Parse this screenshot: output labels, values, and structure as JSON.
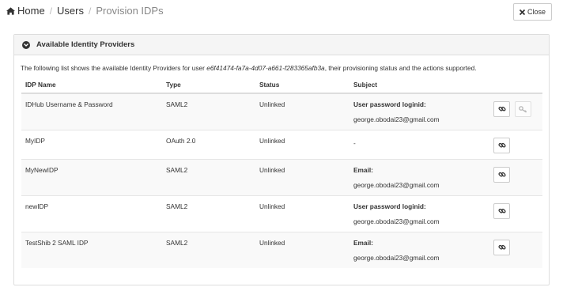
{
  "breadcrumb": {
    "home": "Home",
    "users": "Users",
    "current": "Provision IDPs",
    "separator": "/"
  },
  "close_button": {
    "label": "Close"
  },
  "panel": {
    "title": "Available Identity Providers",
    "intro_prefix": "The following list shows the available Identity Providers for user ",
    "user_id": "e6f41474-fa7a-4d07-a661-f283365afb3a",
    "intro_suffix": ", their provisioning status and the actions supported."
  },
  "table": {
    "columns": [
      "IDP Name",
      "Type",
      "Status",
      "Subject"
    ],
    "rows": [
      {
        "name": "IDHub Username & Password",
        "type": "SAML2",
        "status": "Unlinked",
        "subject_label": "User password loginid:",
        "subject_value": "george.obodai23@gmail.com"
      },
      {
        "name": "MyIDP",
        "type": "OAuth 2.0",
        "status": "Unlinked",
        "subject_label": "",
        "subject_value": "-"
      },
      {
        "name": "MyNewIDP",
        "type": "SAML2",
        "status": "Unlinked",
        "subject_label": "Email:",
        "subject_value": "george.obodai23@gmail.com"
      },
      {
        "name": "newIDP",
        "type": "SAML2",
        "status": "Unlinked",
        "subject_label": "User password loginid:",
        "subject_value": "george.obodai23@gmail.com"
      },
      {
        "name": "TestShib 2 SAML IDP",
        "type": "SAML2",
        "status": "Unlinked",
        "subject_label": "Email:",
        "subject_value": "george.obodai23@gmail.com"
      }
    ]
  },
  "icons": {
    "home": "home-icon",
    "close": "close-x-icon",
    "panel_toggle": "chevron-down-circle-icon",
    "link": "link-icon",
    "key": "key-icon"
  }
}
